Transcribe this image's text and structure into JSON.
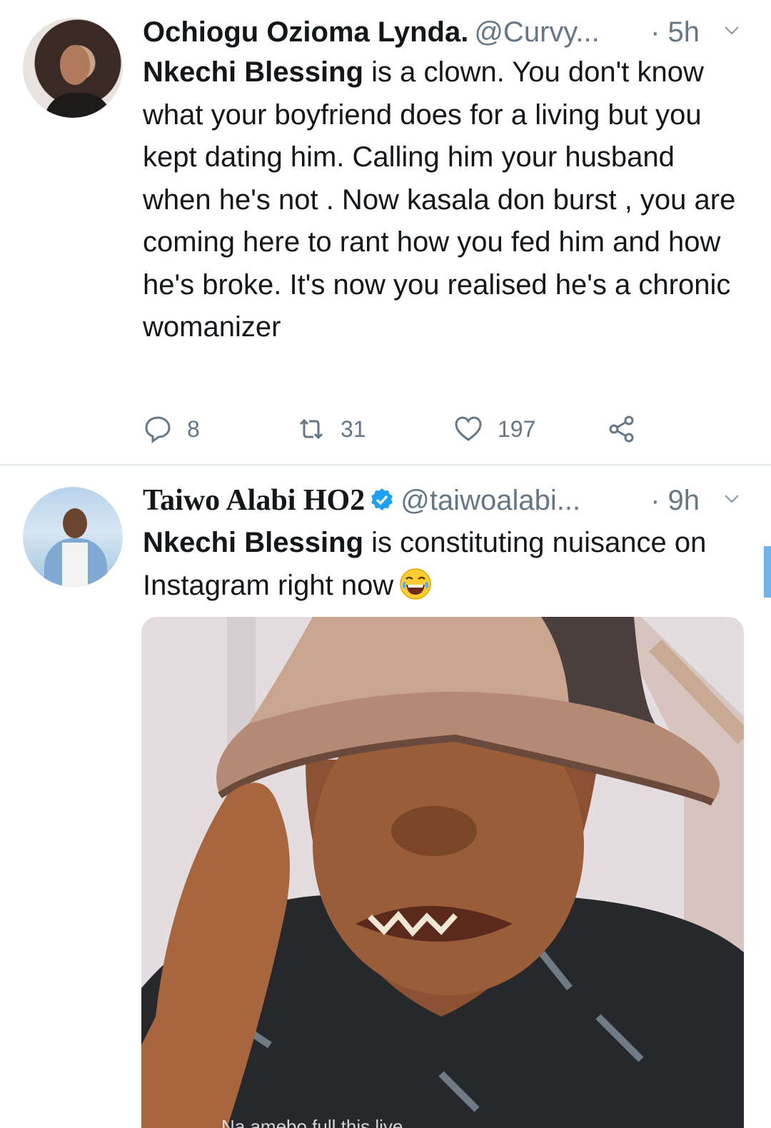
{
  "tweets": [
    {
      "name": "Ochiogu Ozioma Lynda.",
      "handle": "@Curvy...",
      "time": "· 5h",
      "mention": "Nkechi Blessing",
      "text": " is a clown. You don't know what your boyfriend does for a living but you kept dating him. Calling him your husband when he's not . Now kasala don burst , you are coming here to rant how you fed him and how he's broke. It's now you realised he's a chronic womanizer",
      "replies": "8",
      "retweets": "31",
      "likes": "197",
      "icons": [
        "reply-icon",
        "retweet-icon",
        "like-icon",
        "share-icon",
        "chevron-down-icon"
      ]
    },
    {
      "name": "Taiwo Alabi ΗΟ2",
      "handle": "@taiwoalabi...",
      "time": "· 9h",
      "verified": true,
      "mention": "Nkechi Blessing",
      "text": " is constituting nuisance on Instagram right now",
      "emoji": "face-with-tears-of-joy",
      "media_caption": "Na amebo full this live"
    }
  ],
  "colors": {
    "text": "#14171a",
    "secondary": "#657786",
    "divider": "#e1e8ed",
    "verified": "#1da1f2",
    "scrollbar": "#6fb3e8"
  }
}
